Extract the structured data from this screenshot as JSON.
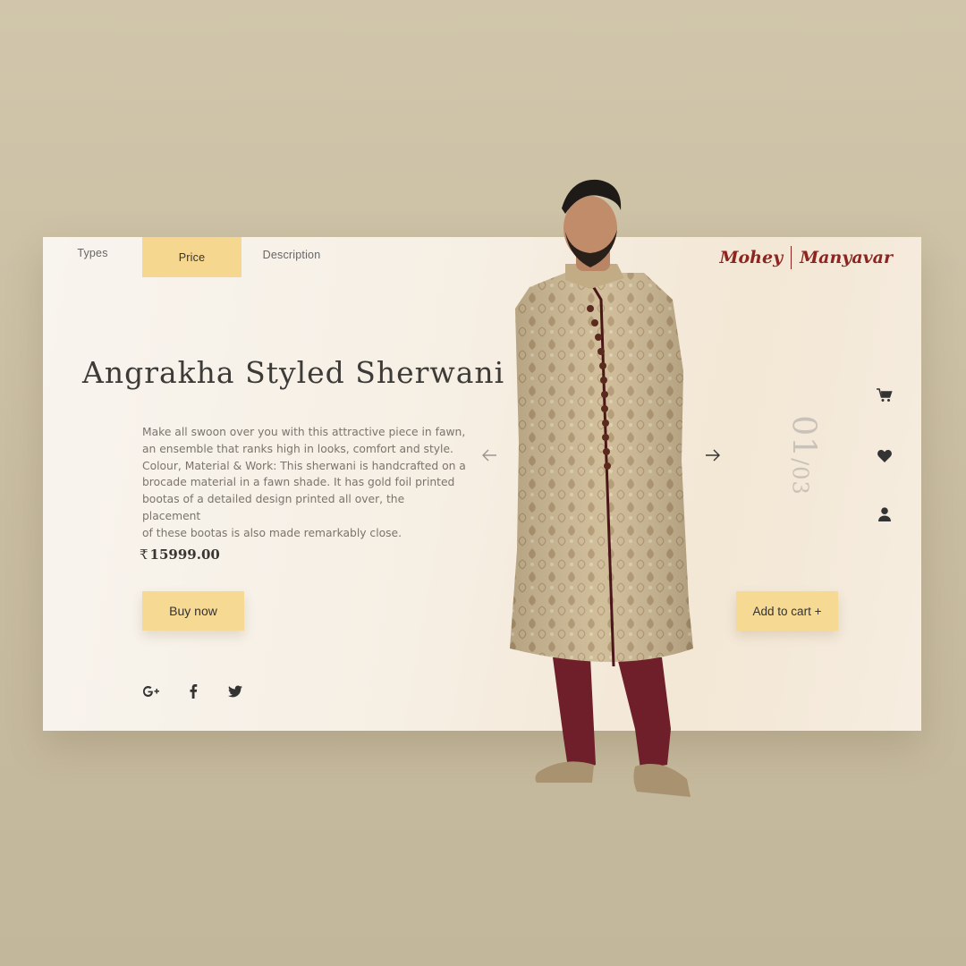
{
  "tabs": [
    {
      "label": "Types"
    },
    {
      "label": "Price"
    },
    {
      "label": "Description"
    }
  ],
  "brand": {
    "left": "Mohey",
    "right": "Manyavar",
    "color": "#8e2420"
  },
  "product": {
    "title": "Angrakha Styled Sherwani",
    "description_lines": [
      "Make all swoon over you with this attractive piece in fawn,",
      "an ensemble that ranks high in looks, comfort and style.",
      "Colour, Material & Work: This sherwani is handcrafted on a",
      "brocade material in a fawn shade.  It has gold foil printed",
      "bootas of a detailed design printed all over, the placement",
      "of these bootas is also made remarkably close."
    ],
    "currency": "₹",
    "price": "15999.00"
  },
  "buttons": {
    "buy": "Buy now",
    "add_to_cart": "Add to cart +"
  },
  "slider": {
    "current": "01",
    "separator": "/",
    "total": "03"
  },
  "social": [
    {
      "name": "google-plus-icon",
      "glyph": "G+"
    },
    {
      "name": "facebook-icon",
      "glyph": "f"
    },
    {
      "name": "twitter-icon",
      "glyph": "twitter"
    }
  ],
  "side_icons": [
    "cart-icon",
    "heart-icon",
    "user-icon"
  ],
  "colors": {
    "accent": "#f6d78f",
    "text": "#3d3b38",
    "brand": "#8e2420"
  }
}
